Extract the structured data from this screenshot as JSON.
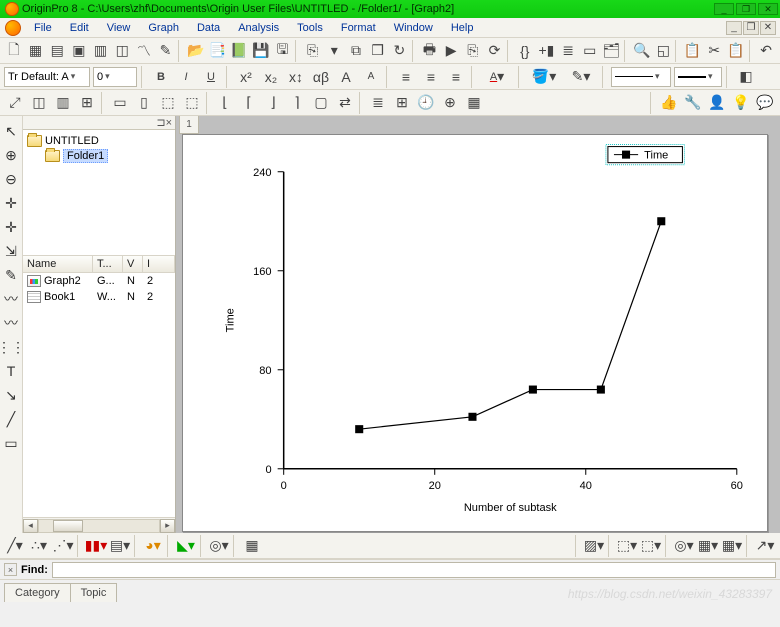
{
  "title": "OriginPro 8 - C:\\Users\\zhf\\Documents\\Origin User Files\\UNTITLED - /Folder1/ - [Graph2]",
  "menu": [
    "File",
    "Edit",
    "View",
    "Graph",
    "Data",
    "Analysis",
    "Tools",
    "Format",
    "Window",
    "Help"
  ],
  "font_toolbar": {
    "style_label": "Tr Default: A",
    "size": "0"
  },
  "tree": {
    "root": "UNTITLED",
    "child": "Folder1"
  },
  "list": {
    "headers": [
      "Name",
      "T...",
      "V",
      "I"
    ],
    "rows": [
      {
        "icon": "graph",
        "name": "Graph2",
        "type": "G...",
        "v": "N",
        "i": "2"
      },
      {
        "icon": "book",
        "name": "Book1",
        "type": "W...",
        "v": "N",
        "i": "2"
      }
    ]
  },
  "page_tab": "1",
  "find_label": "Find:",
  "bottom_tabs": [
    "Category",
    "Topic"
  ],
  "watermark": "https://blog.csdn.net/weixin_43283397",
  "chart_data": {
    "type": "line",
    "series": [
      {
        "name": "Time",
        "x": [
          10,
          25,
          33,
          42,
          50
        ],
        "y": [
          32,
          42,
          64,
          64,
          200
        ]
      }
    ],
    "xlabel": "Number of subtask",
    "ylabel": "Time",
    "xlim": [
      0,
      60
    ],
    "ylim": [
      0,
      240
    ],
    "xticks": [
      0,
      20,
      40,
      60
    ],
    "yticks": [
      0,
      80,
      160,
      240
    ],
    "legend": {
      "entries": [
        "Time"
      ]
    }
  }
}
